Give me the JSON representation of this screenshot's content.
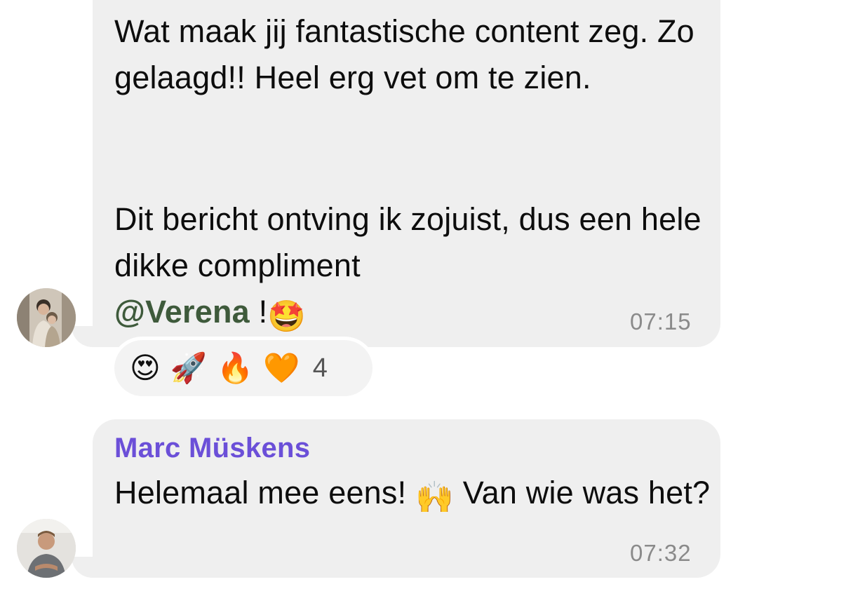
{
  "messages": [
    {
      "paragraph1": "Wat maak jij fantastische content zeg. Zo gelaagd!! Heel erg vet om te zien.",
      "paragraph2": "Dit bericht ontving ik zojuist, dus een hele dikke compliment",
      "mention": "@Verena",
      "suffix": " !",
      "emoji": "🤩",
      "time": "07:15",
      "reactions": [
        "😍",
        "🚀",
        "🔥",
        "🧡"
      ],
      "reaction_count": "4"
    },
    {
      "sender": "Marc Müskens",
      "text_before": "Helemaal mee eens! ",
      "emoji": "🙌",
      "text_after": " Van wie was het?",
      "time": "07:32"
    }
  ],
  "colors": {
    "bubble": "#efefef",
    "sender_name": "#6b4fd8",
    "mention": "#3e5a3b",
    "timestamp": "#8a8a8a"
  }
}
